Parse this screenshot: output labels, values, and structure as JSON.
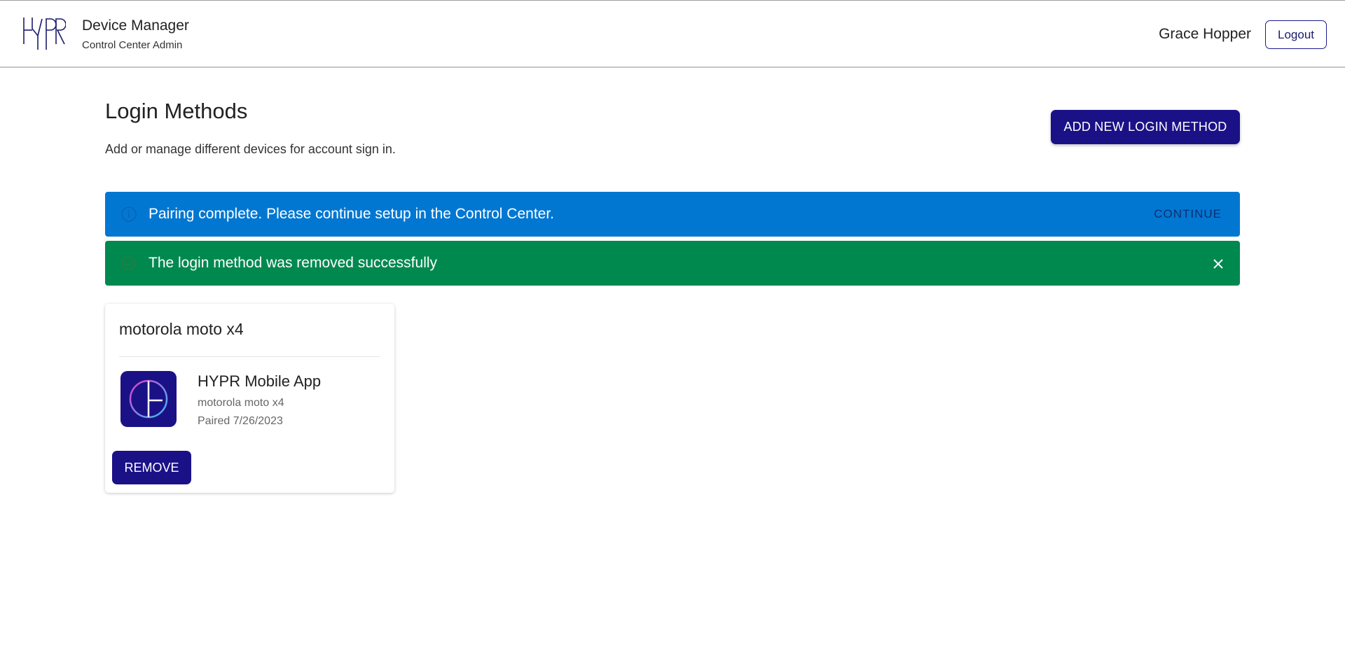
{
  "header": {
    "title": "Device Manager",
    "subtitle": "Control Center Admin",
    "user_name": "Grace Hopper",
    "logout_label": "Logout"
  },
  "main": {
    "title": "Login Methods",
    "description": "Add or manage different devices for account sign in.",
    "add_button_label": "ADD NEW LOGIN METHOD"
  },
  "alerts": {
    "info": {
      "text": "Pairing complete. Please continue setup in the Control Center.",
      "action_label": "CONTINUE",
      "color": "#0277d2"
    },
    "success": {
      "text": "The login method was removed successfully",
      "color": "#00894f"
    }
  },
  "device_card": {
    "title": "motorola moto x4",
    "method_name": "HYPR Mobile App",
    "device": "motorola moto x4",
    "paired": "Paired 7/26/2023",
    "remove_label": "REMOVE",
    "icon": "hypr-app-icon"
  },
  "colors": {
    "brand": "#1b1187"
  }
}
